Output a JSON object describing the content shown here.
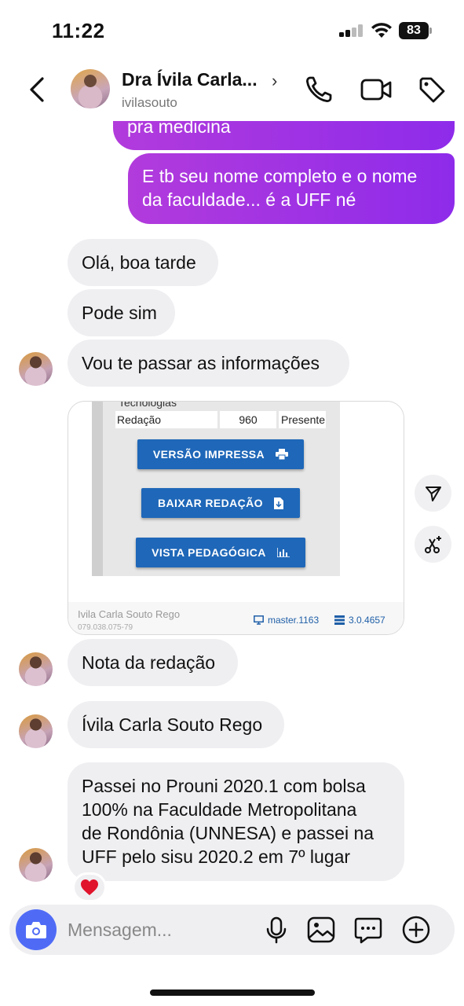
{
  "status_bar": {
    "time": "11:22",
    "battery": "83"
  },
  "header": {
    "contact_name": "Dra Ívila Carla...",
    "username": "ivilasouto",
    "chevron": "›"
  },
  "messages": {
    "out_partial": "pra medicina",
    "out_2": [
      "E tb seu nome completo e o nome",
      "da faculdade... é a UFF né"
    ],
    "in_1": "Olá, boa tarde",
    "in_2": "Pode sim",
    "in_3": "Vou te passar as informações",
    "in_4": "Nota da redação",
    "in_5": "Ívila Carla Souto Rego",
    "in_6": [
      "Passei no Prouni 2020.1 com bolsa",
      "100% na Faculdade Metropolitana",
      "de Rondônia (UNNESA) e passei na",
      "UFF pelo sisu 2020.2 em 7º lugar"
    ]
  },
  "attachment": {
    "section_label": "Tecnologias",
    "row_label": "Redação",
    "row_value": "960",
    "row_status": "Presente",
    "buttons": [
      "VERSÃO IMPRESSA",
      "BAIXAR REDAÇÃO",
      "VISTA PEDAGÓGICA"
    ],
    "footer_name": "Ivila Carla Souto Rego",
    "footer_id": "079.038.075-79",
    "footer_master": "master.1163",
    "footer_version": "3.0.4657"
  },
  "reaction": "❤️",
  "composer": {
    "placeholder": "Mensagem..."
  },
  "colors": {
    "outgoing_start": "#b23bdc",
    "outgoing_end": "#8e2bea",
    "incoming": "#efeff2",
    "camera": "#4f6bf6",
    "doc_button": "#1f67b8"
  },
  "icons": [
    "back-icon",
    "phone-icon",
    "video-icon",
    "tag-icon",
    "share-icon",
    "ai-edit-icon",
    "camera-icon",
    "mic-icon",
    "gallery-icon",
    "sticker-icon",
    "add-icon",
    "printer-icon",
    "download-icon",
    "chart-icon",
    "monitor-icon",
    "server-icon"
  ]
}
